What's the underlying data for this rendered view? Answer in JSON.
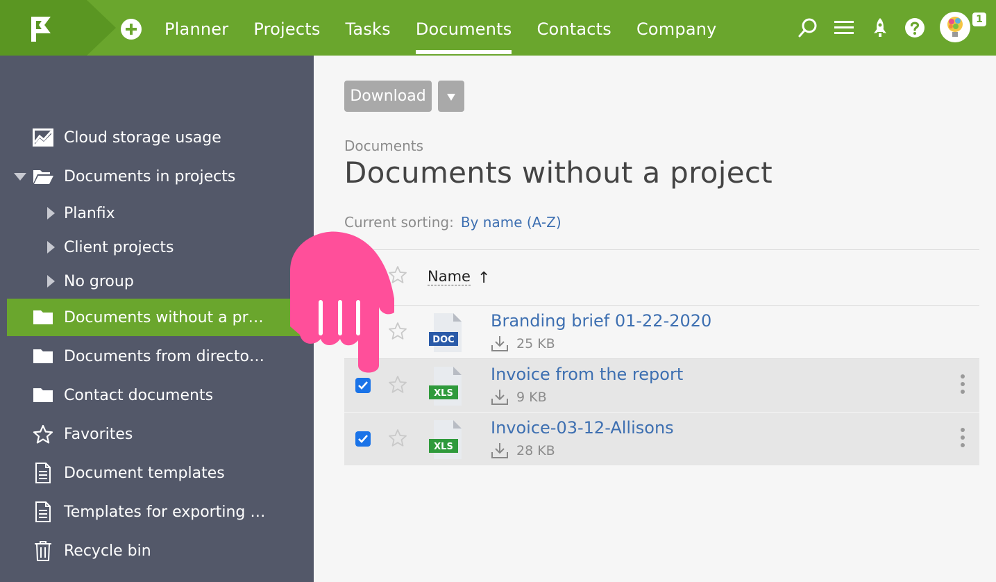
{
  "topbar": {
    "nav": [
      "Planner",
      "Projects",
      "Tasks",
      "Documents",
      "Contacts",
      "Company"
    ],
    "active_nav": "Documents",
    "notification_count": "1",
    "accent_color": "#6aa62d"
  },
  "sidebar": {
    "items": [
      {
        "label": "Cloud storage usage",
        "icon": "chart-icon"
      },
      {
        "label": "Documents in projects",
        "icon": "folder-open-icon"
      },
      {
        "label": "Planfix",
        "icon": "chevron-right-icon"
      },
      {
        "label": "Client projects",
        "icon": "chevron-right-icon"
      },
      {
        "label": "No group",
        "icon": "chevron-right-icon"
      },
      {
        "label": "Documents without a pr…",
        "icon": "folder-icon"
      },
      {
        "label": "Documents from directo…",
        "icon": "folder-icon"
      },
      {
        "label": "Contact documents",
        "icon": "folder-icon"
      },
      {
        "label": "Favorites",
        "icon": "star-icon"
      },
      {
        "label": "Document templates",
        "icon": "document-icon"
      },
      {
        "label": "Templates for exporting …",
        "icon": "document-icon"
      },
      {
        "label": "Recycle bin",
        "icon": "trash-icon"
      }
    ]
  },
  "main": {
    "download_label": "Download",
    "breadcrumb": "Documents",
    "title": "Documents without a project",
    "sorting_label": "Current sorting:",
    "sorting_value": "By name (A-Z)",
    "column_name": "Name",
    "sort_arrow": "↑",
    "files": [
      {
        "name": "Branding brief 01-22-2020",
        "size": "25 KB",
        "type": "DOC",
        "selected": false
      },
      {
        "name": "Invoice from the report",
        "size": "9 KB",
        "type": "XLS",
        "selected": true
      },
      {
        "name": "Invoice-03-12-Allisons",
        "size": "28 KB",
        "type": "XLS",
        "selected": true
      }
    ]
  }
}
